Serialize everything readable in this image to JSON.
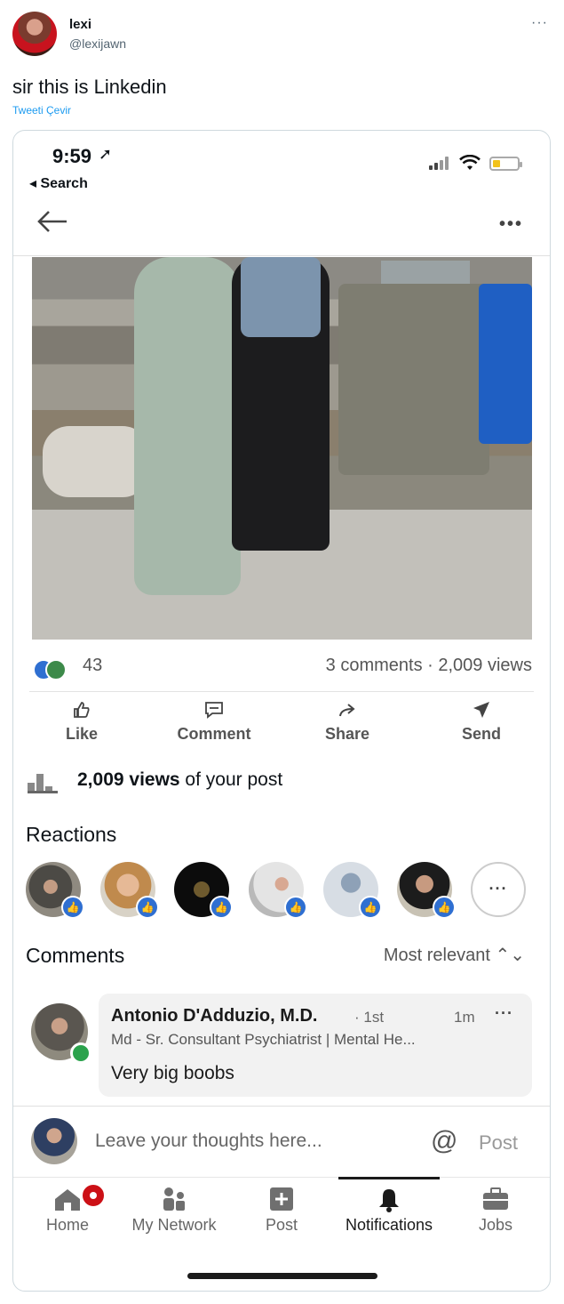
{
  "tweet": {
    "name": "lexi",
    "handle": "@lexijawn",
    "more": "···",
    "text": "sir this is Linkedin",
    "translate": "Tweeti Çevir"
  },
  "phone": {
    "time": "9:59",
    "back_app": "◂ Search"
  },
  "post": {
    "back_icon": "arrow-left-icon",
    "more": "•••",
    "reaction_count": "43",
    "comments_views": "3 comments  ·  2,009 views",
    "actions": [
      {
        "label": "Like",
        "icon": "thumbs-up-icon"
      },
      {
        "label": "Comment",
        "icon": "comment-icon"
      },
      {
        "label": "Share",
        "icon": "share-arrow-icon"
      },
      {
        "label": "Send",
        "icon": "send-icon"
      }
    ],
    "views_bold": "2,009 views",
    "views_rest": " of your post",
    "reactions_title": "Reactions",
    "reactions_more": "···",
    "comments_title": "Comments",
    "sort": "Most relevant ⌃⌄"
  },
  "comment": {
    "name": "Antonio D'Adduzio, M.D.",
    "degree": "· 1st",
    "time": "1m",
    "more": "···",
    "headline": "Md - Sr. Consultant Psychiatrist | Mental He...",
    "text": "Very big boobs"
  },
  "compose": {
    "placeholder": "Leave your thoughts here...",
    "at": "@",
    "post": "Post"
  },
  "tabs": [
    {
      "label": "Home"
    },
    {
      "label": "My Network"
    },
    {
      "label": "Post"
    },
    {
      "label": "Notifications"
    },
    {
      "label": "Jobs"
    }
  ],
  "colors": {
    "linkedin_blue": "#2f6fd1",
    "twitter_blue": "#1d9bf0",
    "notification_red": "#cc1016"
  }
}
